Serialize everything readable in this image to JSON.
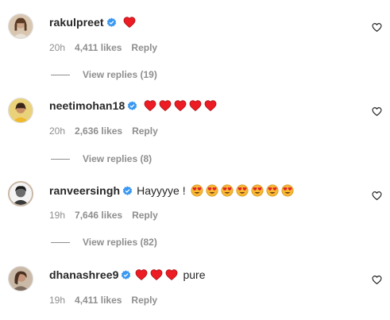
{
  "comments": [
    {
      "username": "rakulpreet",
      "verified": true,
      "text": "",
      "emojis": [
        "red-heart"
      ],
      "time": "20h",
      "likes": "4,411 likes",
      "reply_label": "Reply",
      "view_replies": "View replies (19)"
    },
    {
      "username": "neetimohan18",
      "verified": true,
      "text": "",
      "emojis": [
        "red-heart",
        "red-heart",
        "red-heart",
        "red-heart",
        "red-heart"
      ],
      "time": "20h",
      "likes": "2,636 likes",
      "reply_label": "Reply",
      "view_replies": "View replies (8)"
    },
    {
      "username": "ranveersingh",
      "verified": true,
      "text": "Hayyyye !",
      "emojis": [
        "heart-eyes-face",
        "heart-eyes-face",
        "heart-eyes-face",
        "heart-eyes-face",
        "heart-eyes-face",
        "heart-eyes-face",
        "heart-eyes-face"
      ],
      "time": "19h",
      "likes": "7,646 likes",
      "reply_label": "Reply",
      "view_replies": "View replies (82)"
    },
    {
      "username": "dhanashree9",
      "verified": true,
      "text": "pure",
      "emojis": [
        "red-heart",
        "red-heart",
        "red-heart"
      ],
      "time": "19h",
      "likes": "4,411 likes",
      "reply_label": "Reply",
      "view_replies": ""
    }
  ],
  "colors": {
    "text": "#262626",
    "secondary": "#8e8e8e",
    "verified_blue": "#3897f0",
    "heart_red": "#ed1c24",
    "emoji_yellow": "#f7b733"
  },
  "icons": {
    "verified": "verified-badge-icon",
    "like": "heart-outline-icon"
  }
}
